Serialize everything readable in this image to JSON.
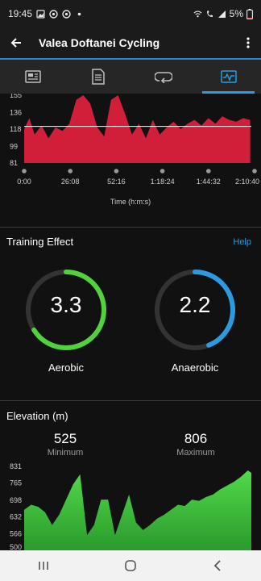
{
  "status_bar": {
    "time": "19:45",
    "battery": "5%"
  },
  "app_bar": {
    "title": "Valea Doftanei Cycling"
  },
  "tabs": [
    {
      "name": "summary",
      "icon": "summary-card-icon",
      "active": false
    },
    {
      "name": "details",
      "icon": "document-list-icon",
      "active": false
    },
    {
      "name": "laps",
      "icon": "laps-loop-icon",
      "active": false
    },
    {
      "name": "charts",
      "icon": "chart-pulse-icon",
      "active": true
    }
  ],
  "heart_rate_chart": {
    "y_ticks": [
      "155",
      "136",
      "118",
      "99",
      "81"
    ],
    "x_ticks": [
      "0:00",
      "26:08",
      "52:16",
      "1:18:24",
      "1:44:32",
      "2:10:40"
    ],
    "x_title": "Time (h:m:s)",
    "fill_color": "#d11f3a"
  },
  "training_effect": {
    "title": "Training Effect",
    "help": "Help",
    "aerobic": {
      "value": "3.3",
      "label": "Aerobic",
      "fraction": 0.66,
      "color": "#4fd23a"
    },
    "anaerobic": {
      "value": "2.2",
      "label": "Anaerobic",
      "fraction": 0.44,
      "color": "#2a9be0"
    }
  },
  "elevation": {
    "title": "Elevation (m)",
    "minimum_value": "525",
    "minimum_label": "Minimum",
    "maximum_value": "806",
    "maximum_label": "Maximum",
    "y_ticks": [
      "831",
      "765",
      "698",
      "632",
      "566",
      "500"
    ]
  },
  "chart_data": [
    {
      "type": "area",
      "title": "",
      "xlabel": "Time (h:m:s)",
      "ylabel": "",
      "ylim": [
        81,
        155
      ],
      "x_tick_labels": [
        "0:00",
        "26:08",
        "52:16",
        "1:18:24",
        "1:44:32",
        "2:10:40"
      ],
      "reference_line": 121,
      "series": [
        {
          "x_minutes": [
            0,
            3,
            6,
            10,
            14,
            18,
            22,
            26,
            30,
            34,
            38,
            42,
            46,
            50,
            54,
            58,
            62,
            66,
            70,
            74,
            78,
            82,
            86,
            90,
            94,
            98,
            102,
            106,
            110,
            114,
            118,
            122,
            126,
            130
          ],
          "values": [
            118,
            130,
            112,
            122,
            108,
            120,
            116,
            124,
            150,
            155,
            146,
            120,
            110,
            150,
            155,
            135,
            112,
            124,
            108,
            128,
            112,
            120,
            126,
            118,
            124,
            128,
            122,
            130,
            124,
            132,
            128,
            126,
            130,
            128
          ]
        }
      ]
    },
    {
      "type": "area",
      "title": "Elevation (m)",
      "xlabel": "",
      "ylabel": "",
      "ylim": [
        500,
        831
      ],
      "y_tick_labels": [
        "831",
        "765",
        "698",
        "632",
        "566",
        "500"
      ],
      "series": [
        {
          "x_minutes": [
            0,
            4,
            8,
            12,
            16,
            20,
            24,
            28,
            32,
            36,
            40,
            44,
            48,
            52,
            56,
            60,
            64,
            68,
            72,
            76,
            80,
            84,
            88,
            92,
            96,
            100,
            104,
            108,
            112,
            116,
            120,
            124,
            128,
            130
          ],
          "values": [
            660,
            680,
            672,
            650,
            600,
            640,
            700,
            760,
            800,
            560,
            600,
            700,
            700,
            560,
            640,
            720,
            610,
            580,
            600,
            625,
            640,
            660,
            680,
            675,
            700,
            695,
            710,
            720,
            740,
            755,
            770,
            790,
            815,
            806
          ]
        }
      ]
    }
  ]
}
